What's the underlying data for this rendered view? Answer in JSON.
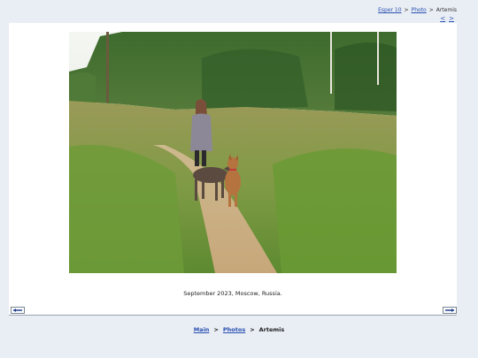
{
  "header": {
    "breadcrumb": [
      {
        "label": "Esper 10",
        "link": true
      },
      {
        "label": "Photo",
        "link": true
      },
      {
        "label": "Artemis",
        "link": false
      }
    ],
    "separator": ">",
    "prev_label": "<",
    "next_label": ">"
  },
  "photo": {
    "caption": "September 2023, Moscow, Russia."
  },
  "footer": {
    "breadcrumb": [
      {
        "label": "Main",
        "link": true
      },
      {
        "label": "Photos",
        "link": true
      },
      {
        "label": "Artemis",
        "link": false
      }
    ],
    "separator": ">"
  },
  "colors": {
    "link": "#2a4fb0",
    "background": "#e9eef5",
    "card": "#ffffff"
  },
  "icons": {
    "prev": "arrow-left-icon",
    "next": "arrow-right-icon"
  }
}
